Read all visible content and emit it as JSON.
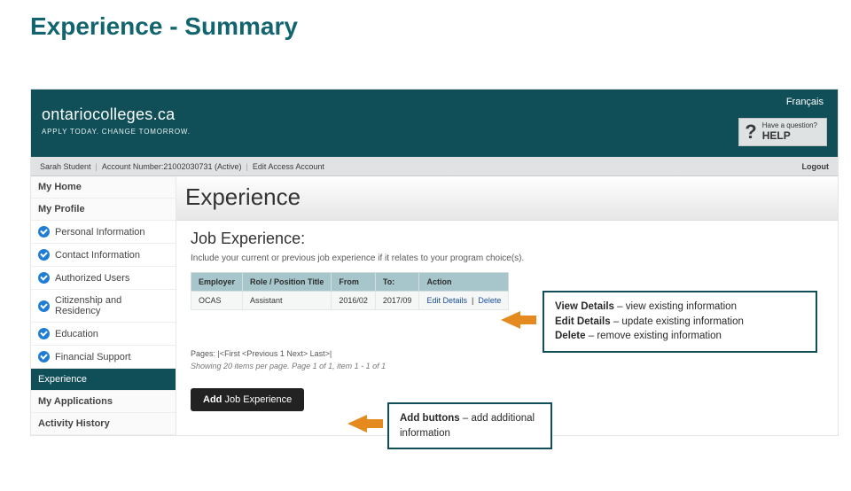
{
  "slide": {
    "title": "Experience - Summary"
  },
  "header": {
    "language": "Français",
    "brand_name": "ontariocolleges.ca",
    "brand_tagline": "APPLY TODAY. CHANGE TOMORROW.",
    "help_small": "Have a question?",
    "help_big": "HELP"
  },
  "account": {
    "name": "Sarah Student",
    "acct_label": "Account Number:",
    "acct_num": "21002030731",
    "status": "(Active)",
    "edit": "Edit Access Account",
    "logout": "Logout"
  },
  "sidebar": {
    "my_home": "My Home",
    "my_profile": "My Profile",
    "items": [
      "Personal Information",
      "Contact Information",
      "Authorized Users",
      "Citizenship and Residency",
      "Education",
      "Financial Support"
    ],
    "active": "Experience",
    "my_apps": "My Applications",
    "activity": "Activity History"
  },
  "main": {
    "page_title": "Experience",
    "section_title": "Job Experience:",
    "description": "Include your current or previous job experience if it relates to your program choice(s).",
    "cols": {
      "employer": "Employer",
      "role": "Role / Position Title",
      "from": "From",
      "to": "To:",
      "action": "Action"
    },
    "row": {
      "employer": "OCAS",
      "role": "Assistant",
      "from": "2016/02",
      "to": "2017/09",
      "edit": "Edit Details",
      "delete": "Delete"
    },
    "pager": "Pages: |<First <Previous 1 Next> Last>|",
    "pager_sub": "Showing 20 items per page. Page 1 of 1, item 1 - 1 of 1",
    "add_btn_prefix": "Add ",
    "add_btn_rest": "Job Experience"
  },
  "callouts": {
    "c1_l1a": "View Details",
    "c1_l1b": " – view existing information",
    "c1_l2a": "Edit Details",
    "c1_l2b": " – update existing information",
    "c1_l3a": "Delete",
    "c1_l3b": " – remove existing information",
    "c2_a": "Add buttons",
    "c2_b": " – add additional information"
  }
}
